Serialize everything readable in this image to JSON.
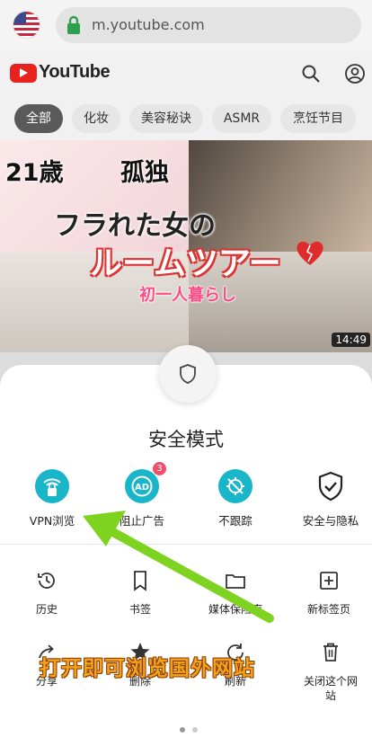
{
  "browser": {
    "url": "m.youtube.com",
    "flag": "us-flag",
    "lock_icon": "lock-icon"
  },
  "youtube": {
    "logo_text": "YouTube",
    "icons": [
      "search-icon",
      "account-icon"
    ],
    "chips": [
      "全部",
      "化妆",
      "美容秘诀",
      "ASMR",
      "烹饪节目"
    ]
  },
  "video": {
    "overlay_1": "21歳",
    "overlay_2": "孤独",
    "overlay_3": "フラれた女の",
    "overlay_4": "ルームツアー",
    "overlay_5": "初一人暮らし",
    "duration": "14:49"
  },
  "sheet": {
    "title": "安全模式",
    "features": [
      {
        "label": "VPN浏览",
        "icon": "wifi-lock-icon"
      },
      {
        "label": "阻止广告",
        "icon": "ad-block-icon",
        "badge": "3"
      },
      {
        "label": "不跟踪",
        "icon": "no-tracking-icon"
      },
      {
        "label": "安全与隐私",
        "icon": "shield-check-icon"
      }
    ],
    "grid_row1": [
      {
        "label": "历史",
        "icon": "history-icon"
      },
      {
        "label": "书签",
        "icon": "bookmark-icon"
      },
      {
        "label": "媒体保险库",
        "icon": "folder-icon"
      },
      {
        "label": "新标签页",
        "icon": "new-tab-icon"
      }
    ],
    "grid_row2": [
      {
        "label": "分享",
        "icon": "share-icon"
      },
      {
        "label": "删除",
        "icon": "star-icon"
      },
      {
        "label": "刷新",
        "icon": "refresh-icon"
      },
      {
        "label": "关闭这个网站",
        "icon": "trash-icon"
      }
    ]
  },
  "annotation": {
    "text": "打开即可浏览国外网站",
    "color": "#f3a21c",
    "arrow_color": "#7ed321"
  },
  "colors": {
    "accent": "#19b5c9",
    "youtube_red": "#e8231f",
    "badge": "#ee4f6b"
  }
}
